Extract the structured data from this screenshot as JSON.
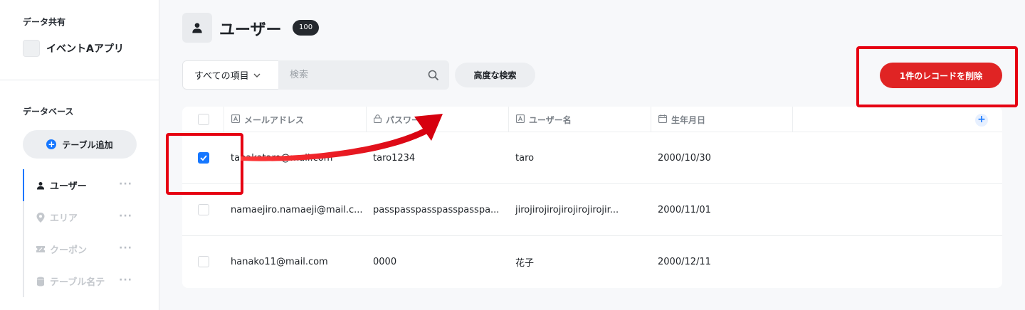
{
  "sidebar": {
    "share_title": "データ共有",
    "app_name": "イベントAアプリ",
    "db_title": "データベース",
    "add_table_label": "テーブル追加",
    "items": [
      {
        "label": "ユーザー",
        "icon": "user-icon",
        "active": true
      },
      {
        "label": "エリア",
        "icon": "location-pin-icon",
        "active": false
      },
      {
        "label": "クーポン",
        "icon": "coupon-icon",
        "active": false
      },
      {
        "label": "テーブル名テ",
        "icon": "database-icon",
        "active": false
      }
    ]
  },
  "header": {
    "title": "ユーザー",
    "count": "100"
  },
  "toolbar": {
    "field_select": "すべての項目",
    "search_placeholder": "検索",
    "advanced_search_label": "高度な検索",
    "delete_label": "1件のレコードを削除"
  },
  "table": {
    "columns": [
      {
        "label": "メールアドレス",
        "icon": "text-field-icon"
      },
      {
        "label": "パスワード",
        "icon": "lock-icon"
      },
      {
        "label": "ユーザー名",
        "icon": "text-field-icon"
      },
      {
        "label": "生年月日",
        "icon": "calendar-icon"
      }
    ],
    "rows": [
      {
        "checked": true,
        "email": "tanakataro@mail.com",
        "password": "taro1234",
        "username": "taro",
        "birthday": "2000/10/30"
      },
      {
        "checked": false,
        "email": "namaejiro.namaeji@mail.c...",
        "password": "passpasspasspasspasspa...",
        "username": "jirojirojirojirojirojirojir...",
        "birthday": "2000/11/01"
      },
      {
        "checked": false,
        "email": "hanako11@mail.com",
        "password": "0000",
        "username": "花子",
        "birthday": "2000/12/11"
      }
    ]
  },
  "colors": {
    "accent": "#1677ff",
    "danger": "#e02424",
    "annotation": "#e60012"
  }
}
